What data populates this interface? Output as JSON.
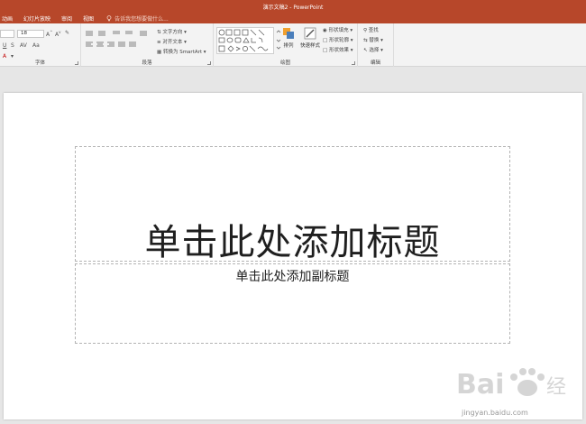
{
  "window": {
    "title": "演示文稿2 - PowerPoint"
  },
  "tabs": [
    {
      "label": "动画"
    },
    {
      "label": "幻灯片放映"
    },
    {
      "label": "审阅"
    },
    {
      "label": "视图"
    }
  ],
  "tell_me": {
    "placeholder": "告诉我您想要做什么..."
  },
  "ribbon": {
    "font": {
      "label": "字体",
      "size_value": "18"
    },
    "paragraph": {
      "label": "段落",
      "text_direction": "文字方向",
      "align_text": "对齐文本",
      "convert_smartart": "转换为 SmartArt"
    },
    "drawing": {
      "label": "绘图",
      "arrange": "排列",
      "quick_styles": "快速样式",
      "shape_fill": "形状填充",
      "shape_outline": "形状轮廓",
      "shape_effects": "形状效果"
    },
    "editing": {
      "label": "编辑",
      "find": "查找",
      "replace": "替换",
      "select": "选择"
    }
  },
  "slide": {
    "title_placeholder": "单击此处添加标题",
    "subtitle_placeholder": "单击此处添加副标题"
  },
  "watermark": {
    "brand": "Baidu 经验",
    "url": "jingyan.baidu.com"
  },
  "colors": {
    "accent": "#b7472a",
    "ribbon_bg": "#f3f3f3",
    "workspace_bg": "#e6e6e6"
  }
}
